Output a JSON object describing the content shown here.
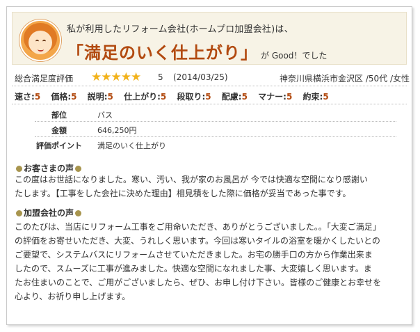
{
  "header": {
    "line1": "私が利用したリフォーム会社(ホームプロ加盟会社)は、",
    "main": "「満足のいく仕上がり」",
    "sub": "が Good！でした"
  },
  "rating": {
    "label": "総合満足度評価",
    "stars": 5,
    "stars_text": "★★★★★",
    "score": "5",
    "date": "(2014/03/25)",
    "location": "神奈川県横浜市金沢区 /50代 /女性"
  },
  "criteria": [
    {
      "label": "速さ:",
      "value": "5"
    },
    {
      "label": "価格:",
      "value": "5"
    },
    {
      "label": "説明:",
      "value": "5"
    },
    {
      "label": "仕上がり:",
      "value": "5"
    },
    {
      "label": "段取り:",
      "value": "5"
    },
    {
      "label": "配慮:",
      "value": "5"
    },
    {
      "label": "マナー:",
      "value": "5"
    },
    {
      "label": "約束:",
      "value": "5"
    }
  ],
  "details": [
    {
      "key": "部位",
      "value": "バス"
    },
    {
      "key": "金額",
      "value": "646,250円"
    },
    {
      "key": "評価ポイント",
      "value": "満足のいく仕上がり"
    }
  ],
  "customer": {
    "heading": "お客さまの声",
    "lines": [
      "この度はお世話になりました。寒い、汚い、我が家のお風呂が 今では快適な空間になり感謝い",
      "たします。【工事をした会社に決めた理由】相見積をした際に価格が妥当であった事です。"
    ]
  },
  "company": {
    "heading": "加盟会社の声",
    "lines": [
      "このたびは、当店にリフォーム工事をご用命いただき、ありがとうございました。。「大変ご満足」",
      "の評価をお寄せいただき、大変、うれしく思います。今回は寒いタイルの浴室を暖かくしたいとの",
      "ご要望で、システムバスにリフォームさせていただきました。お宅の勝手口の方から作業出来ま",
      "したので、スムーズに工事が進みました。快適な空間になれました事、大変嬉しく思います。ま",
      "たお住まいのことで、ご用がございましたら、ぜひ、お申し付け下さい。皆様のご健康とお幸せを",
      "心より、お祈り申し上げます。"
    ]
  },
  "colors": {
    "accent": "#b24a10",
    "star": "#f2b21a",
    "header_bg": "#f7f3e6",
    "bullet": "#a8954e"
  }
}
